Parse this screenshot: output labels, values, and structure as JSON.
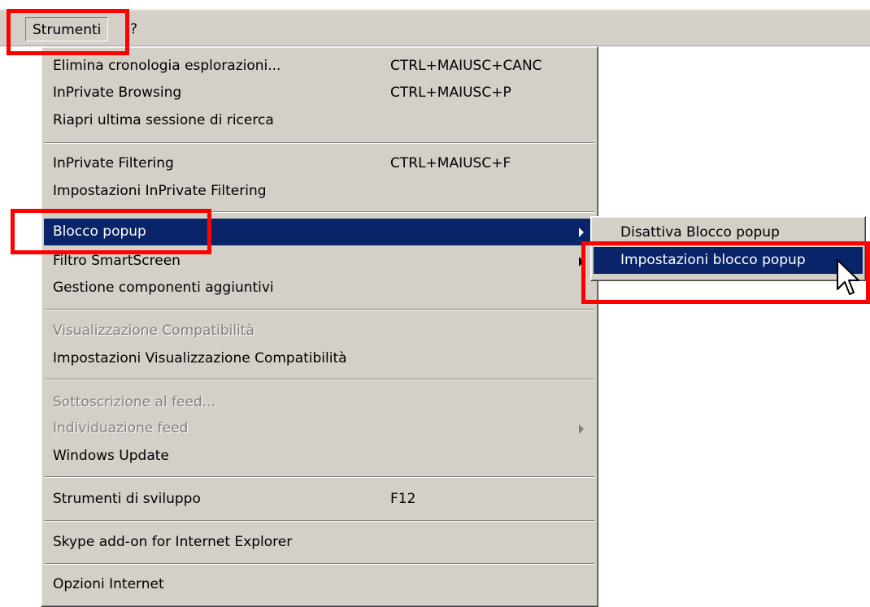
{
  "menubar": {
    "items": [
      {
        "label": "Strumenti"
      },
      {
        "label": "?"
      }
    ]
  },
  "tools_menu": {
    "items": [
      {
        "label": "Elimina cronologia esplorazioni...",
        "shortcut": "CTRL+MAIUSC+CANC"
      },
      {
        "label": "InPrivate Browsing",
        "shortcut": "CTRL+MAIUSC+P"
      },
      {
        "label": "Riapri ultima sessione di ricerca",
        "shortcut": ""
      },
      {
        "label": "InPrivate Filtering",
        "shortcut": "CTRL+MAIUSC+F"
      },
      {
        "label": "Impostazioni InPrivate Filtering",
        "shortcut": ""
      },
      {
        "label": "Blocco popup",
        "shortcut": ""
      },
      {
        "label": "Filtro SmartScreen",
        "shortcut": ""
      },
      {
        "label": "Gestione componenti aggiuntivi",
        "shortcut": ""
      },
      {
        "label": "Visualizzazione Compatibilità",
        "shortcut": ""
      },
      {
        "label": "Impostazioni Visualizzazione Compatibilità",
        "shortcut": ""
      },
      {
        "label": "Sottoscrizione al feed...",
        "shortcut": ""
      },
      {
        "label": "Individuazione feed",
        "shortcut": ""
      },
      {
        "label": "Windows Update",
        "shortcut": ""
      },
      {
        "label": "Strumenti di sviluppo",
        "shortcut": "F12"
      },
      {
        "label": "Skype add-on for Internet Explorer",
        "shortcut": ""
      },
      {
        "label": "Opzioni Internet",
        "shortcut": ""
      }
    ]
  },
  "popup_submenu": {
    "items": [
      {
        "label": "Disattiva Blocco popup"
      },
      {
        "label": "Impostazioni blocco popup"
      }
    ]
  },
  "colors": {
    "menu_bg": "#d4d0c8",
    "highlight": "#0a246a",
    "annotation": "#ff0000",
    "disabled_text": "#808080"
  },
  "icons": [
    "submenu-arrow-icon",
    "mouse-pointer-icon"
  ]
}
